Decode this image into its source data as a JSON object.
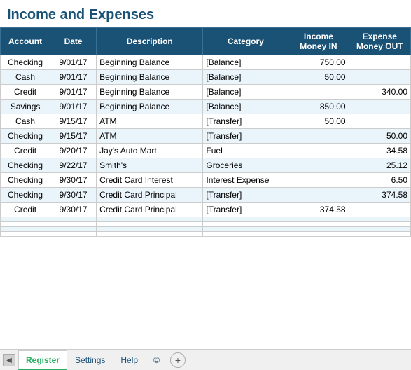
{
  "page": {
    "title": "Income and Expenses"
  },
  "table": {
    "columns": [
      {
        "key": "account",
        "label": "Account"
      },
      {
        "key": "date",
        "label": "Date"
      },
      {
        "key": "description",
        "label": "Description"
      },
      {
        "key": "category",
        "label": "Category"
      },
      {
        "key": "income",
        "label": "Income\nMoney IN"
      },
      {
        "key": "expense",
        "label": "Expense\nMoney OUT"
      }
    ],
    "rows": [
      {
        "account": "Checking",
        "date": "9/01/17",
        "description": "Beginning Balance",
        "category": "[Balance]",
        "income": "750.00",
        "expense": ""
      },
      {
        "account": "Cash",
        "date": "9/01/17",
        "description": "Beginning Balance",
        "category": "[Balance]",
        "income": "50.00",
        "expense": ""
      },
      {
        "account": "Credit",
        "date": "9/01/17",
        "description": "Beginning Balance",
        "category": "[Balance]",
        "income": "",
        "expense": "340.00"
      },
      {
        "account": "Savings",
        "date": "9/01/17",
        "description": "Beginning Balance",
        "category": "[Balance]",
        "income": "850.00",
        "expense": ""
      },
      {
        "account": "Cash",
        "date": "9/15/17",
        "description": "ATM",
        "category": "[Transfer]",
        "income": "50.00",
        "expense": ""
      },
      {
        "account": "Checking",
        "date": "9/15/17",
        "description": "ATM",
        "category": "[Transfer]",
        "income": "",
        "expense": "50.00"
      },
      {
        "account": "Credit",
        "date": "9/20/17",
        "description": "Jay's Auto Mart",
        "category": "Fuel",
        "income": "",
        "expense": "34.58"
      },
      {
        "account": "Checking",
        "date": "9/22/17",
        "description": "Smith's",
        "category": "Groceries",
        "income": "",
        "expense": "25.12"
      },
      {
        "account": "Checking",
        "date": "9/30/17",
        "description": "Credit Card Interest",
        "category": "Interest Expense",
        "income": "",
        "expense": "6.50"
      },
      {
        "account": "Checking",
        "date": "9/30/17",
        "description": "Credit Card Principal",
        "category": "[Transfer]",
        "income": "",
        "expense": "374.58"
      },
      {
        "account": "Credit",
        "date": "9/30/17",
        "description": "Credit Card Principal",
        "category": "[Transfer]",
        "income": "374.58",
        "expense": ""
      },
      {
        "account": "",
        "date": "",
        "description": "",
        "category": "",
        "income": "",
        "expense": ""
      },
      {
        "account": "",
        "date": "",
        "description": "",
        "category": "",
        "income": "",
        "expense": ""
      },
      {
        "account": "",
        "date": "",
        "description": "",
        "category": "",
        "income": "",
        "expense": ""
      },
      {
        "account": "",
        "date": "",
        "description": "",
        "category": "",
        "income": "",
        "expense": ""
      }
    ]
  },
  "tabs": [
    {
      "label": "Register",
      "active": true
    },
    {
      "label": "Settings",
      "active": false
    },
    {
      "label": "Help",
      "active": false
    },
    {
      "label": "©",
      "active": false
    }
  ],
  "bottom": {
    "nav_left": "◀",
    "add_tab": "+"
  }
}
